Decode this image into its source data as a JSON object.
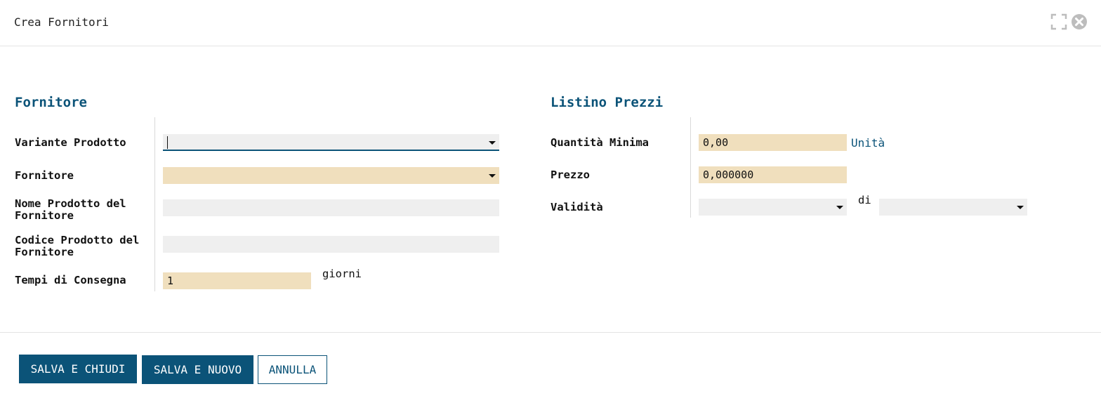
{
  "header": {
    "title": "Crea Fornitori"
  },
  "left_section": {
    "title": "Fornitore",
    "fields": {
      "variante_prodotto": {
        "label": "Variante Prodotto",
        "value": ""
      },
      "fornitore": {
        "label": "Fornitore",
        "value": ""
      },
      "nome_prodotto": {
        "label": "Nome Prodotto del Fornitore",
        "value": ""
      },
      "codice_prodotto": {
        "label": "Codice Prodotto del Fornitore",
        "value": ""
      },
      "tempi_consegna": {
        "label": "Tempi di Consegna",
        "value": "1",
        "unit": "giorni"
      }
    }
  },
  "right_section": {
    "title": "Listino Prezzi",
    "fields": {
      "quantita_minima": {
        "label": "Quantità Minima",
        "value": "0,00",
        "unit": "Unità"
      },
      "prezzo": {
        "label": "Prezzo",
        "value": "0,000000"
      },
      "validita": {
        "label": "Validità",
        "from": "",
        "separator": "di",
        "to": ""
      }
    }
  },
  "footer": {
    "save_close": "SALVA E CHIUDI",
    "save_new": "SALVA E NUOVO",
    "cancel": "ANNULLA"
  },
  "icons": {
    "expand": "expand-icon",
    "close": "close-icon"
  },
  "colors": {
    "accent": "#0b5378",
    "required_field": "#f0dfbd",
    "field": "#efefef"
  }
}
